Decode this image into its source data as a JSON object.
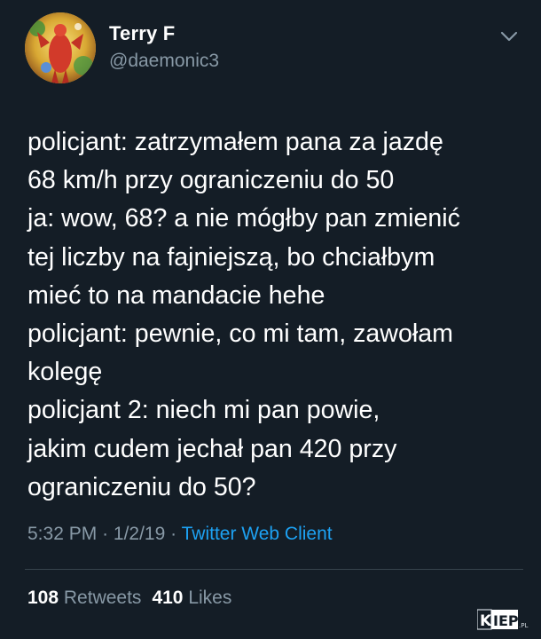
{
  "user": {
    "name": "Terry F",
    "handle": "@daemonic3"
  },
  "tweet": {
    "lines": [
      "policjant: zatrzymałem pana za jazdę",
      "68 km/h przy ograniczeniu do 50",
      "ja: wow, 68? a nie mógłby pan zmienić",
      "tej liczby na fajniejszą, bo chciałbym",
      "mieć to na mandacie hehe",
      "policjant: pewnie, co mi tam, zawołam",
      "kolegę",
      "policjant 2: niech mi pan powie,",
      "jakim cudem jechał pan 420 przy",
      "ograniczeniu do 50?"
    ],
    "time": "5:32 PM",
    "date": "1/2/19",
    "separator": "·",
    "client": "Twitter Web Client"
  },
  "stats": {
    "retweets_count": "108",
    "retweets_label": "Retweets",
    "likes_count": "410",
    "likes_label": "Likes"
  },
  "watermark": {
    "text": "KIEP.PL"
  },
  "colors": {
    "background": "#141d26",
    "text": "#ffffff",
    "secondary": "#8899a6",
    "link": "#1da1f2",
    "divider": "#38444d"
  },
  "icons": {
    "avatar": "avatar",
    "menu": "chevron-down-icon"
  }
}
